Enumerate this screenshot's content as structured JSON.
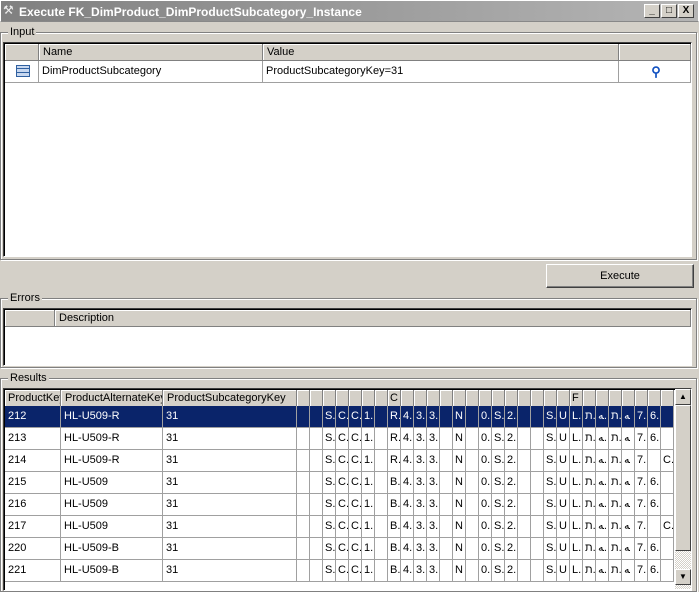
{
  "window": {
    "title": "Execute FK_DimProduct_DimProductSubcategory_Instance",
    "minimize": "_",
    "maximize": "□",
    "close": "X"
  },
  "input": {
    "label": "Input",
    "columns": [
      "",
      "Name",
      "Value",
      ""
    ],
    "rows": [
      {
        "icon": "table-icon",
        "name": "DimProductSubcategory",
        "value": "ProductSubcategoryKey=31",
        "action": "search-icon"
      }
    ]
  },
  "execute_label": "Execute",
  "errors": {
    "label": "Errors",
    "columns": [
      "",
      "Description"
    ]
  },
  "results": {
    "label": "Results",
    "columns": [
      "ProductKey",
      "ProductAlternateKey",
      "ProductSubcategoryKey"
    ],
    "narrow_headers": [
      "",
      "",
      "",
      "",
      "",
      "",
      "",
      "C",
      "",
      "",
      "",
      "",
      "",
      "",
      "",
      "",
      "",
      "",
      "",
      "",
      "",
      "F",
      "",
      "",
      "",
      "",
      "",
      "",
      ""
    ],
    "selected_row": 0,
    "rows": [
      {
        "k": "212",
        "a": "HL-U509-R",
        "s": "31",
        "c": [
          "",
          "",
          "S.",
          "C.",
          "C.",
          "1.",
          "",
          "R.",
          "4.",
          "3.",
          "3.",
          "",
          "N",
          "",
          "0.",
          "S.",
          "2.",
          "",
          "",
          "S.",
          "U",
          "L.",
          "ת..",
          "ﻪ.",
          "ת.",
          "ﻪ",
          "7.",
          "6.",
          ""
        ]
      },
      {
        "k": "213",
        "a": "HL-U509-R",
        "s": "31",
        "c": [
          "",
          "",
          "S.",
          "C.",
          "C.",
          "1.",
          "",
          "R.",
          "4.",
          "3.",
          "3.",
          "",
          "N",
          "",
          "0.",
          "S.",
          "2.",
          "",
          "",
          "S.",
          "U",
          "L.",
          "ת..",
          "ﻪ.",
          "ת.",
          "ﻪ",
          "7.",
          "6.",
          ""
        ]
      },
      {
        "k": "214",
        "a": "HL-U509-R",
        "s": "31",
        "c": [
          "",
          "",
          "S.",
          "C.",
          "C.",
          "1.",
          "",
          "R.",
          "4.",
          "3.",
          "3.",
          "",
          "N",
          "",
          "0.",
          "S.",
          "2.",
          "",
          "",
          "S.",
          "U",
          "L.",
          "ת..",
          "ﻪ.",
          "ת.",
          "ﻪ",
          "7.",
          "",
          "C."
        ]
      },
      {
        "k": "215",
        "a": "HL-U509",
        "s": "31",
        "c": [
          "",
          "",
          "S.",
          "C.",
          "C.",
          "1.",
          "",
          "B.",
          "4.",
          "3.",
          "3.",
          "",
          "N",
          "",
          "0.",
          "S.",
          "2.",
          "",
          "",
          "S.",
          "U",
          "L.",
          "ת..",
          "ﻪ.",
          "ת.",
          "ﻪ",
          "7.",
          "6.",
          ""
        ]
      },
      {
        "k": "216",
        "a": "HL-U509",
        "s": "31",
        "c": [
          "",
          "",
          "S.",
          "C.",
          "C.",
          "1.",
          "",
          "B.",
          "4.",
          "3.",
          "3.",
          "",
          "N",
          "",
          "0.",
          "S.",
          "2.",
          "",
          "",
          "S.",
          "U",
          "L.",
          "ת..",
          "ﻪ.",
          "ת.",
          "ﻪ",
          "7.",
          "6.",
          ""
        ]
      },
      {
        "k": "217",
        "a": "HL-U509",
        "s": "31",
        "c": [
          "",
          "",
          "S.",
          "C.",
          "C.",
          "1.",
          "",
          "B.",
          "4.",
          "3.",
          "3.",
          "",
          "N",
          "",
          "0.",
          "S.",
          "2.",
          "",
          "",
          "S.",
          "U",
          "L.",
          "ת..",
          "ﻪ.",
          "ת.",
          "ﻪ",
          "7.",
          "",
          "C."
        ]
      },
      {
        "k": "220",
        "a": "HL-U509-B",
        "s": "31",
        "c": [
          "",
          "",
          "S.",
          "C.",
          "C.",
          "1.",
          "",
          "B.",
          "4.",
          "3.",
          "3.",
          "",
          "N",
          "",
          "0.",
          "S.",
          "2.",
          "",
          "",
          "S.",
          "U",
          "L.",
          "ת..",
          "ﻪ.",
          "ת.",
          "ﻪ",
          "7.",
          "6.",
          ""
        ]
      },
      {
        "k": "221",
        "a": "HL-U509-B",
        "s": "31",
        "c": [
          "",
          "",
          "S.",
          "C.",
          "C.",
          "1.",
          "",
          "B.",
          "4.",
          "3.",
          "3.",
          "",
          "N",
          "",
          "0.",
          "S.",
          "2.",
          "",
          "",
          "S.",
          "U",
          "L.",
          "ת..",
          "ﻪ.",
          "ת.",
          "ﻪ",
          "7.",
          "6.",
          ""
        ]
      }
    ]
  }
}
